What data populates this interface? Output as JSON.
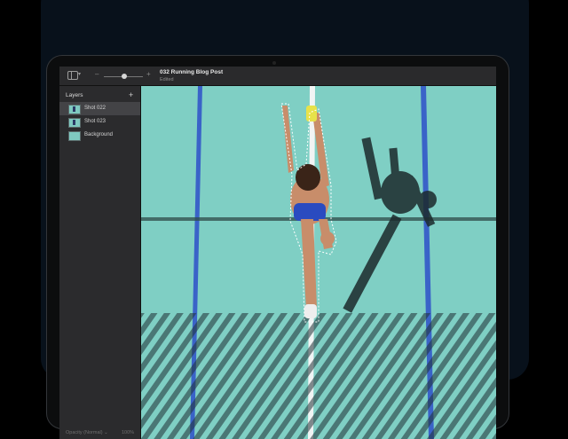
{
  "toolbar": {
    "document_title": "032 Running Blog Post",
    "document_status": "Edited",
    "zoom_minus": "–",
    "zoom_plus": "+"
  },
  "sidebar": {
    "title": "Layers",
    "add_glyph": "+",
    "layers": [
      {
        "label": "Shot 022",
        "selected": true
      },
      {
        "label": "Shot 023",
        "selected": false
      },
      {
        "label": "Background",
        "selected": false
      }
    ],
    "footer_label": "Opacity (Normal) ⌄",
    "footer_value": "100%"
  },
  "colors": {
    "track": "#7fcfc4",
    "lane_line": "#3a63c8",
    "bezel": "#0c0d0e",
    "app_bg": "#2b2b2d"
  }
}
